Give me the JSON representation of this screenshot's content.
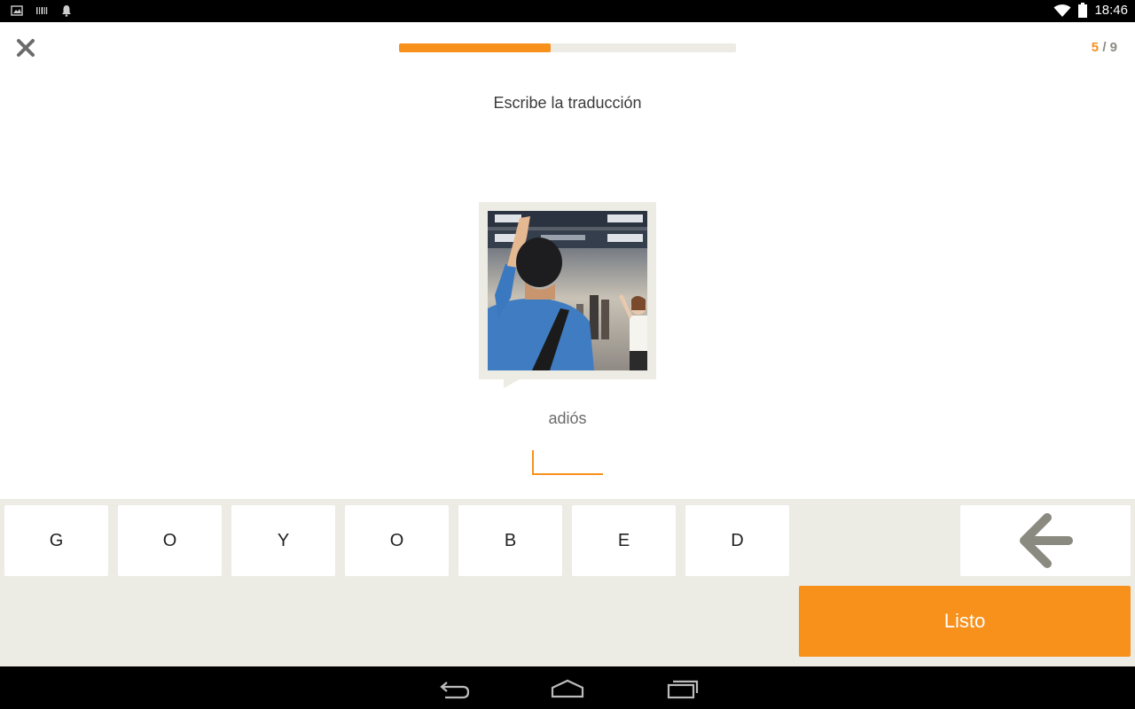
{
  "status_bar": {
    "time": "18:46",
    "left_icons": [
      "image-icon",
      "barcode-icon",
      "bell-icon"
    ],
    "right_icons": [
      "wifi-icon",
      "battery-icon"
    ]
  },
  "progress": {
    "current": "5",
    "separator": "/",
    "total": "9",
    "fraction": 0.45
  },
  "instruction": "Escribe la traducción",
  "picture": {
    "icon": "person-waving-photo"
  },
  "word": "adiós",
  "answer": {
    "value": ""
  },
  "keyboard": {
    "keys": [
      "G",
      "O",
      "Y",
      "O",
      "B",
      "E",
      "D"
    ],
    "backspace_icon": "arrow-left-icon",
    "done_label": "Listo"
  },
  "colors": {
    "accent": "#f8901c",
    "keyboard_bg": "#ecebe4",
    "progress_track": "#ecebe4"
  },
  "nav_bar": {
    "icons": [
      "back-icon",
      "home-icon",
      "recents-icon"
    ]
  }
}
